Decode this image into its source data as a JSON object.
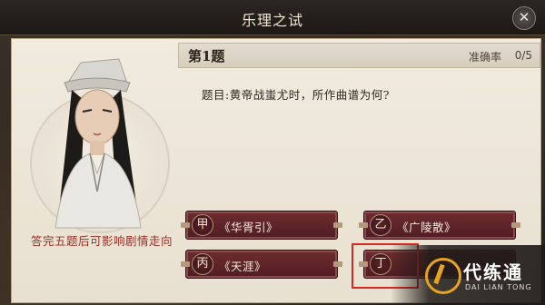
{
  "window": {
    "title": "乐理之试"
  },
  "portrait": {
    "caption": "答完五题后可影响剧情走向"
  },
  "question": {
    "number_label": "第1题",
    "accuracy_label": "准确率",
    "accuracy_value": "0/5",
    "text": "题目:黄帝战蚩尤时，所作曲谱为何?"
  },
  "answers": [
    {
      "badge": "甲",
      "text": "《华胥引》"
    },
    {
      "badge": "乙",
      "text": "《广陵散》"
    },
    {
      "badge": "丙",
      "text": "《天涯》"
    },
    {
      "badge": "丁",
      "text": ""
    }
  ],
  "watermark": {
    "cn": "代练通",
    "en": "DAI LIAN TONG"
  },
  "icons": [
    "close-icon",
    "character-portrait"
  ],
  "colors": {
    "caption": "#9b2e22",
    "answer_bg": "#5e2428",
    "highlight": "#d62a1e",
    "watermark_accent": "#e9a41f"
  }
}
